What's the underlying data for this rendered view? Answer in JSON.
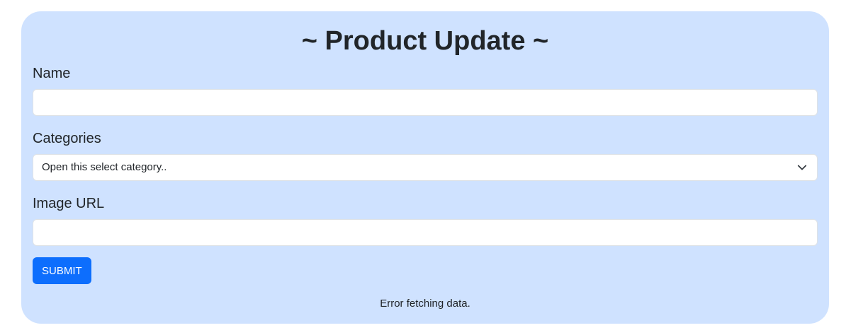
{
  "form": {
    "title": "~ Product Update ~",
    "name_label": "Name",
    "name_value": "",
    "categories_label": "Categories",
    "categories_selected": "Open this select category..",
    "image_label": "Image URL",
    "image_value": "",
    "submit_label": "SUBMIT",
    "status_message": "Error fetching data."
  },
  "colors": {
    "card_background": "#cfe2ff",
    "primary_button": "#0d6efd"
  }
}
